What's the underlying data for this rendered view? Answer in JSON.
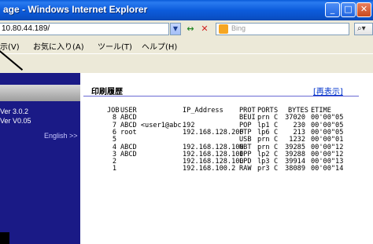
{
  "window": {
    "title": "age - Windows Internet Explorer"
  },
  "address": {
    "url": "10.80.44.189/"
  },
  "search": {
    "placeholder": "Bing"
  },
  "menu": {
    "items": [
      "示(V)",
      "お気に入り(A)",
      "ツール(T)",
      "ヘルプ(H)"
    ]
  },
  "sidebar": {
    "items": [
      {
        "label": "Ver 3.0.2"
      },
      {
        "label": "Ver V0.05"
      },
      {
        "label": "English >>"
      }
    ]
  },
  "main": {
    "heading": "印刷履歴",
    "refresh_label": "[再表示]",
    "columns": [
      "JOB",
      "USER",
      "IP_Address",
      "PROT",
      "PORT",
      "S",
      "BYTES",
      "ETIME"
    ],
    "rows": [
      {
        "job": "8",
        "user": "ABCD",
        "ip": "",
        "prot": "BEUI",
        "port": "prn",
        "s": "C",
        "bytes": "37020",
        "etime": "00'00\"05"
      },
      {
        "job": "7",
        "user": "ABCD <user1@abc.",
        "ip": "192",
        "prot": "POP",
        "port": "lp1",
        "s": "C",
        "bytes": "230",
        "etime": "00'00\"05"
      },
      {
        "job": "6",
        "user": "root",
        "ip": "192.168.128.200",
        "prot": "FTP",
        "port": "lp6",
        "s": "C",
        "bytes": "213",
        "etime": "00'00\"05"
      },
      {
        "job": "5",
        "user": "",
        "ip": "",
        "prot": "USB",
        "port": "prn",
        "s": "C",
        "bytes": "1232",
        "etime": "00'00\"01"
      },
      {
        "job": "4",
        "user": "ABCD",
        "ip": "192.168.128.100",
        "prot": "NBT",
        "port": "prn",
        "s": "C",
        "bytes": "39285",
        "etime": "00'00\"12"
      },
      {
        "job": "3",
        "user": "ABCD",
        "ip": "192.168.128.100",
        "prot": "IPP",
        "port": "lp2",
        "s": "C",
        "bytes": "39288",
        "etime": "00'00\"12"
      },
      {
        "job": "2",
        "user": "",
        "ip": "192.168.128.100",
        "prot": "LPD",
        "port": "lp3",
        "s": "C",
        "bytes": "39914",
        "etime": "00'00\"13"
      },
      {
        "job": "1",
        "user": "",
        "ip": "192.168.100.2",
        "prot": "RAW",
        "port": "pr3",
        "s": "C",
        "bytes": "38089",
        "etime": "00'00\"14"
      }
    ]
  },
  "icons": {
    "minimize": "minimize-icon",
    "maximize": "maximize-icon",
    "close": "close-icon",
    "search": "search-icon"
  }
}
